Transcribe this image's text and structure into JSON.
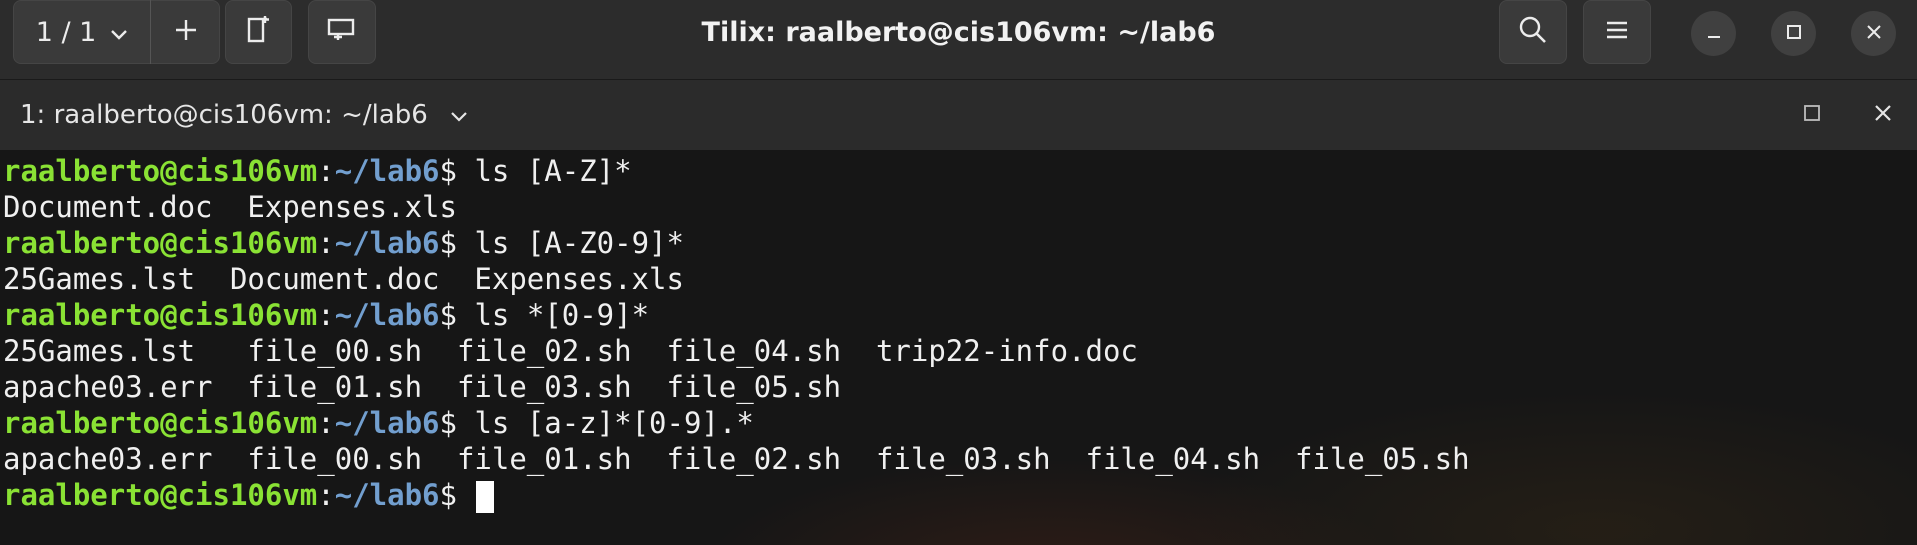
{
  "titlebar": {
    "session_label": "1 / 1",
    "title": "Tilix: raalberto@cis106vm: ~/lab6"
  },
  "tabbar": {
    "tab_title": "1: raalberto@cis106vm: ~/lab6"
  },
  "terminal": {
    "prompt_user": "raalberto@cis106vm",
    "prompt_sep": ":",
    "prompt_path": "~/lab6",
    "prompt_symbol": "$",
    "commands": [
      "ls [A-Z]*",
      "ls [A-Z0-9]*",
      "ls *[0-9]*",
      "ls [a-z]*[0-9].*"
    ],
    "outputs": [
      "Document.doc  Expenses.xls",
      "25Games.lst  Document.doc  Expenses.xls",
      "25Games.lst   file_00.sh  file_02.sh  file_04.sh  trip22-info.doc",
      "apache03.err  file_01.sh  file_03.sh  file_05.sh",
      "apache03.err  file_00.sh  file_01.sh  file_02.sh  file_03.sh  file_04.sh  file_05.sh"
    ]
  },
  "colors": {
    "prompt_user": "#8ae234",
    "prompt_path": "#729fcf",
    "text": "#f0f0f0"
  },
  "icons": [
    "chevron-down-icon",
    "plus-icon",
    "split-right-icon",
    "split-down-icon",
    "search-icon",
    "hamburger-menu-icon",
    "minimize-icon",
    "maximize-icon",
    "close-icon"
  ]
}
